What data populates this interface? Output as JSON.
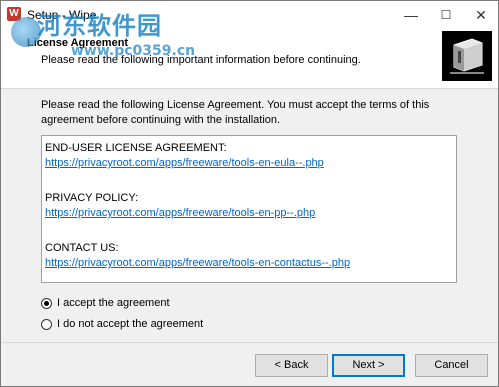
{
  "titlebar": {
    "icon_letter": "W",
    "title": "Setup - Wipe",
    "minimize_glyph": "—",
    "maximize_glyph": "☐",
    "close_glyph": "✕"
  },
  "watermark": {
    "site_name": "河东软件园",
    "site_url": "www.pc0359.cn"
  },
  "header": {
    "title": "License Agreement",
    "subtitle": "Please read the following important information before continuing."
  },
  "main": {
    "intro": "Please read the following License Agreement. You must accept the terms of this agreement before continuing with the installation.",
    "license": {
      "eula_label": "END-USER LICENSE AGREEMENT:",
      "eula_link": "https://privacyroot.com/apps/freeware/tools-en-eula--.php",
      "privacy_label": "PRIVACY POLICY:",
      "privacy_link": "https://privacyroot.com/apps/freeware/tools-en-pp--.php",
      "contact_label": "CONTACT US:",
      "contact_link": "https://privacyroot.com/apps/freeware/tools-en-contactus--.php"
    },
    "options": {
      "accept": "I accept the agreement",
      "decline": "I do not accept the agreement",
      "selected": "accept"
    }
  },
  "footer": {
    "back": "< Back",
    "next": "Next >",
    "cancel": "Cancel"
  }
}
